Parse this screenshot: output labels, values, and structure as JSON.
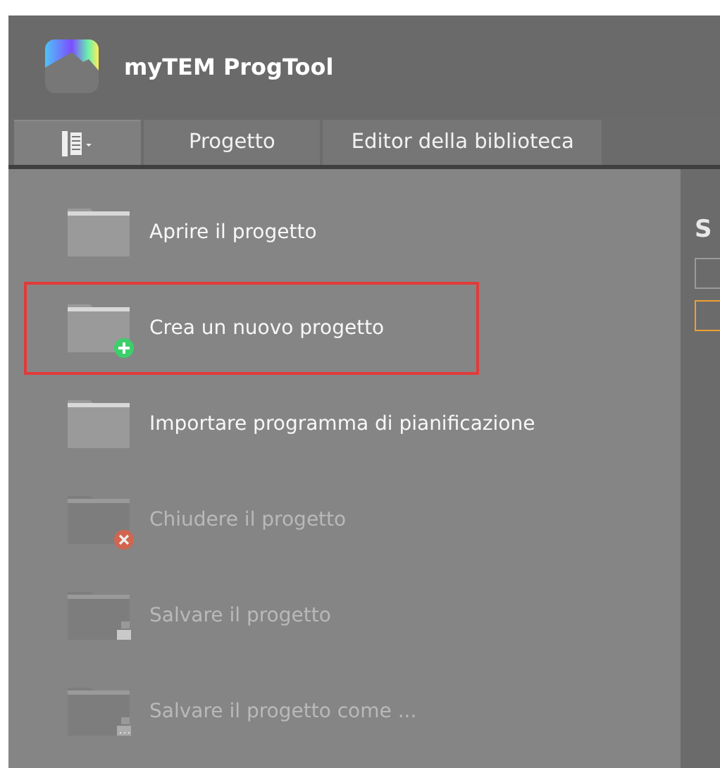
{
  "window": {
    "title": "myTEM ProgTool"
  },
  "tabs": [
    {
      "kind": "menu",
      "selected": true
    },
    {
      "kind": "text",
      "label": "Progetto",
      "selected": false
    },
    {
      "kind": "text",
      "label": "Editor della biblioteca",
      "selected": false
    }
  ],
  "menu": [
    {
      "label": "Aprire il progetto",
      "kind": "none",
      "disabled": false,
      "highlighted": false
    },
    {
      "label": "Crea un nuovo progetto",
      "kind": "plus",
      "disabled": false,
      "highlighted": true
    },
    {
      "label": "Importare programma di pianificazione",
      "kind": "none",
      "disabled": false,
      "highlighted": false
    },
    {
      "label": "Chiudere il progetto",
      "kind": "close",
      "disabled": true,
      "highlighted": false
    },
    {
      "label": "Salvare il progetto",
      "kind": "save",
      "disabled": true,
      "highlighted": false
    },
    {
      "label": "Salvare il progetto come ...",
      "kind": "saveas",
      "disabled": true,
      "highlighted": false
    }
  ],
  "side_pane": {
    "heading": "S"
  }
}
